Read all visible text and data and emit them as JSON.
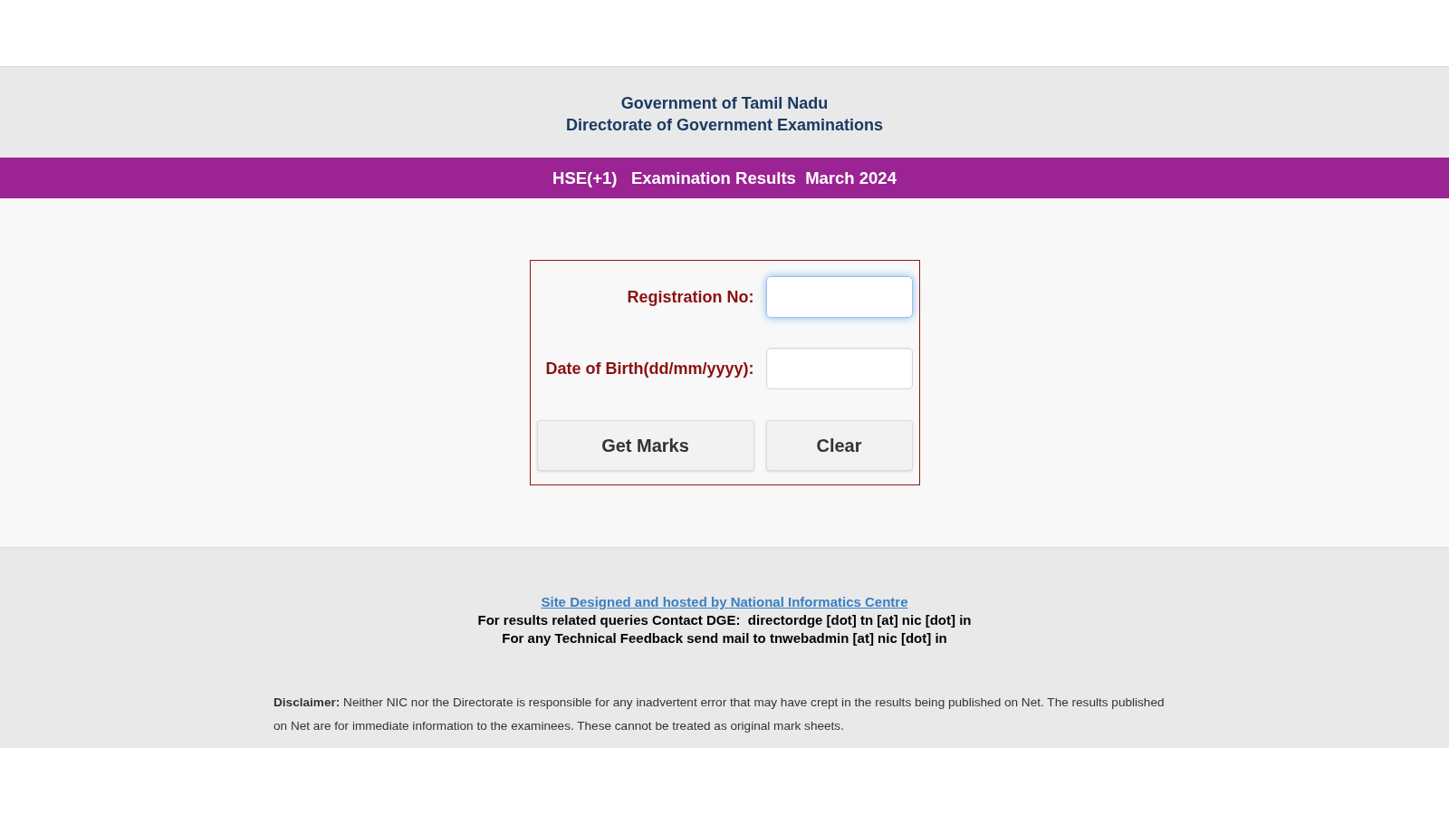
{
  "header": {
    "lines": [
      "Government of Tamil Nadu",
      "Directorate of Government Examinations"
    ]
  },
  "banner": {
    "title": "HSE(+1)   Examination Results  March 2024"
  },
  "form": {
    "fields": [
      {
        "label": "Registration No:",
        "focused": true
      },
      {
        "label": "Date of Birth(dd/mm/yyyy):",
        "focused": false
      }
    ],
    "buttons": [
      "Get Marks",
      "Clear"
    ]
  },
  "footer": {
    "link": "Site Designed and hosted by National Informatics Centre",
    "lines": [
      "For results related queries Contact DGE:  directordge [dot] tn [at] nic [dot] in",
      "For any Technical Feedback send mail to tnwebadmin [at] nic [dot] in"
    ],
    "disclaimer": "**Disclaimer:** Neither NIC nor the Directorate is responsible for any inadvertent error that may have crept in the results being published on Net. The results published on Net are for immediate information to the examinees. These cannot be treated as original mark sheets."
  }
}
